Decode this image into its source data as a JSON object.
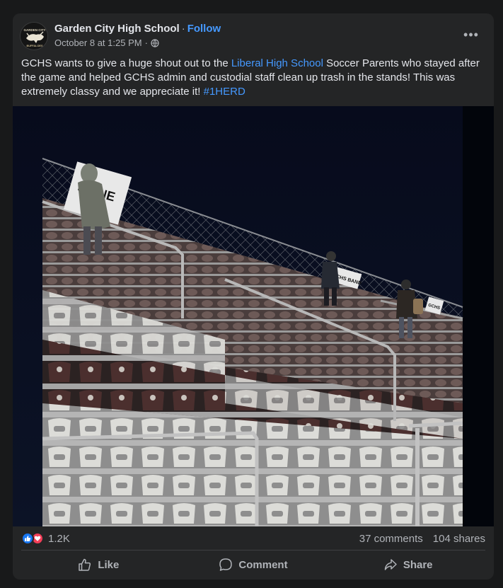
{
  "post": {
    "author": "Garden City High School",
    "separator": "·",
    "follow_label": "Follow",
    "timestamp": "October 8 at 1:25 PM",
    "meta_separator": "·",
    "audience_icon": "globe-icon",
    "more_icon": "more-options-icon",
    "more_label": "•••",
    "avatar_text_top": "GARDEN CITY",
    "avatar_text_bottom": "BUFFALOES",
    "text": {
      "part1": "GCHS wants to give a huge shout out to the ",
      "link1": "Liberal High School",
      "part2": " Soccer Parents who stayed after the game and helped GCHS admin and custodial staff clean up trash in the stands! This was extremely classy and we appreciate it! ",
      "hashtag": "#1HERD"
    },
    "photo": {
      "sign1": "SE   NE",
      "sign2": "GCHS BAND",
      "sign3": "GCHS"
    }
  },
  "stats": {
    "reaction_icons": [
      "like-icon",
      "love-icon"
    ],
    "reaction_count": "1.2K",
    "comments": "37 comments",
    "shares": "104 shares"
  },
  "actions": {
    "like": "Like",
    "comment": "Comment",
    "share": "Share"
  },
  "colors": {
    "background": "#18191a",
    "card": "#242526",
    "link": "#4599ff",
    "like_blue": "#1877f2",
    "love_red": "#f33e58"
  }
}
